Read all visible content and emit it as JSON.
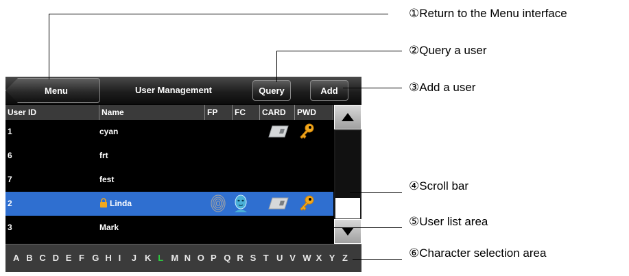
{
  "toolbar": {
    "menu_label": "Menu",
    "title": "User Management",
    "query_label": "Query",
    "add_label": "Add"
  },
  "columns": [
    "User ID",
    "Name",
    "FP",
    "FC",
    "CARD",
    "PWD"
  ],
  "rows": [
    {
      "id": "1",
      "name": "cyan",
      "fp": false,
      "fc": false,
      "card": true,
      "pwd": true,
      "locked": false,
      "selected": false
    },
    {
      "id": "6",
      "name": "frt",
      "fp": false,
      "fc": false,
      "card": false,
      "pwd": false,
      "locked": false,
      "selected": false
    },
    {
      "id": "7",
      "name": "fest",
      "fp": false,
      "fc": false,
      "card": false,
      "pwd": false,
      "locked": false,
      "selected": false
    },
    {
      "id": "2",
      "name": "Linda",
      "fp": true,
      "fc": true,
      "card": true,
      "pwd": true,
      "locked": true,
      "selected": true
    },
    {
      "id": "3",
      "name": "Mark",
      "fp": false,
      "fc": false,
      "card": false,
      "pwd": false,
      "locked": false,
      "selected": false
    }
  ],
  "alphabet": [
    "A",
    "B",
    "C",
    "D",
    "E",
    "F",
    "G",
    "H",
    "I",
    "J",
    "K",
    "L",
    "M",
    "N",
    "O",
    "P",
    "Q",
    "R",
    "S",
    "T",
    "U",
    "V",
    "W",
    "X",
    "Y",
    "Z"
  ],
  "active_letter": "L",
  "callouts": {
    "c1": "①Return to the Menu interface",
    "c2": "②Query a user",
    "c3": "③Add a user",
    "c4": "④Scroll bar",
    "c5": "⑤User list area",
    "c6": "⑥Character selection area"
  },
  "icons": {
    "scroll_up": "triangle-up-icon",
    "scroll_down": "triangle-down-icon",
    "fingerprint": "fingerprint-icon",
    "face": "face-icon",
    "card": "card-icon",
    "password": "key-icon",
    "lock": "lock-icon"
  },
  "colors": {
    "selected_row": "#2f6fd0",
    "active_letter": "#2ecc40",
    "key": "#f2a81d",
    "face": "#4ab0d8"
  }
}
